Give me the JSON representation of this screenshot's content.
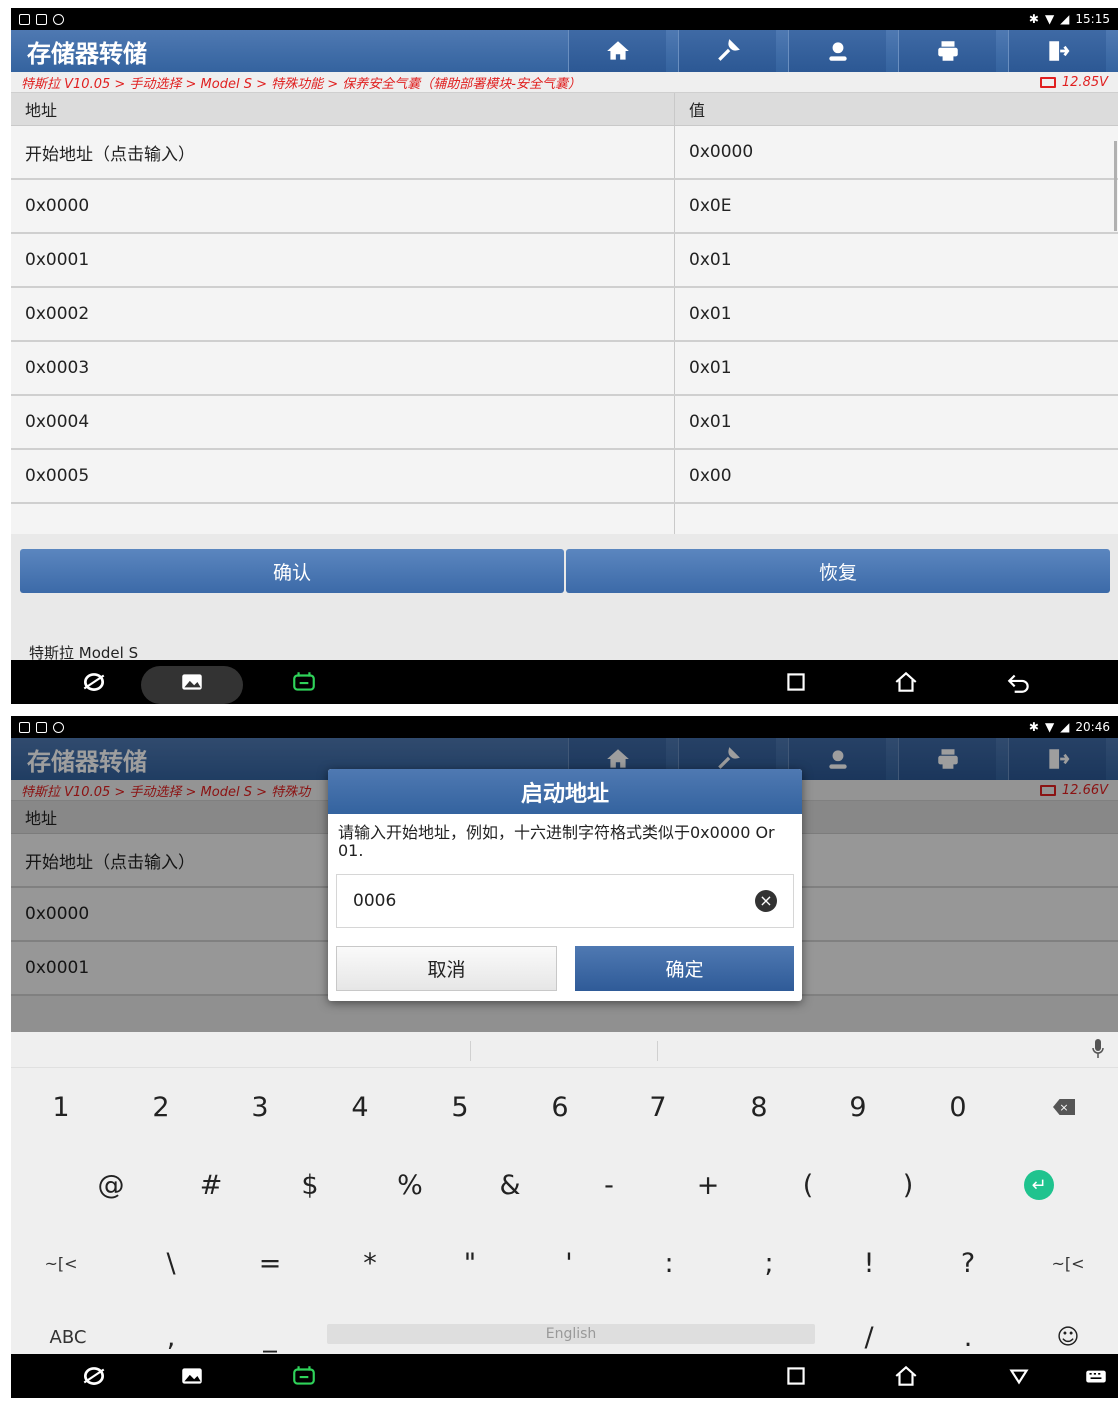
{
  "screen1": {
    "status_time": "15:15",
    "app_title": "存储器转储",
    "breadcrumb": "特斯拉 V10.05 > 手动选择 > Model S > 特殊功能 > 保养安全气囊（辅助部署模块-安全气囊）",
    "voltage": "12.85V",
    "table_headers": [
      "地址",
      "值"
    ],
    "rows": [
      {
        "addr": "开始地址（点击输入）",
        "val": "0x0000"
      },
      {
        "addr": "0x0000",
        "val": "0x0E"
      },
      {
        "addr": "0x0001",
        "val": "0x01"
      },
      {
        "addr": "0x0002",
        "val": "0x01"
      },
      {
        "addr": "0x0003",
        "val": "0x01"
      },
      {
        "addr": "0x0004",
        "val": "0x01"
      },
      {
        "addr": "0x0005",
        "val": "0x00"
      }
    ],
    "confirm_label": "确认",
    "restore_label": "恢复",
    "footer_label": "特斯拉 Model S"
  },
  "screen2": {
    "status_time": "20:46",
    "app_title": "存储器转储",
    "breadcrumb": "特斯拉 V10.05 > 手动选择 > Model S > 特殊功",
    "voltage": "12.66V",
    "table_header": "地址",
    "rows": [
      {
        "addr": "开始地址（点击输入）"
      },
      {
        "addr": "0x0000"
      },
      {
        "addr": "0x0001"
      }
    ],
    "dialog": {
      "title": "启动地址",
      "message": "请输入开始地址，例如，十六进制字符格式类似于0x0000 Or 01.",
      "input_value": "0006",
      "cancel_label": "取消",
      "ok_label": "确定"
    },
    "keyboard": {
      "row1": [
        "1",
        "2",
        "3",
        "4",
        "5",
        "6",
        "7",
        "8",
        "9",
        "0"
      ],
      "row2": [
        "@",
        "#",
        "$",
        "%",
        "&",
        "-",
        "+",
        "(",
        ")"
      ],
      "row3": [
        "~[<",
        "\\",
        "=",
        "*",
        "\"",
        "'",
        ":",
        ";",
        "!",
        "?",
        "~[<"
      ],
      "abc_label": "ABC",
      "comma": ",",
      "underscore": "_",
      "space_label": "English",
      "slash": "/",
      "period": "."
    }
  },
  "colors": {
    "accent_blue": "#3c6aa8",
    "breadcrumb_red": "#e02020",
    "enter_green": "#1fc38e"
  }
}
